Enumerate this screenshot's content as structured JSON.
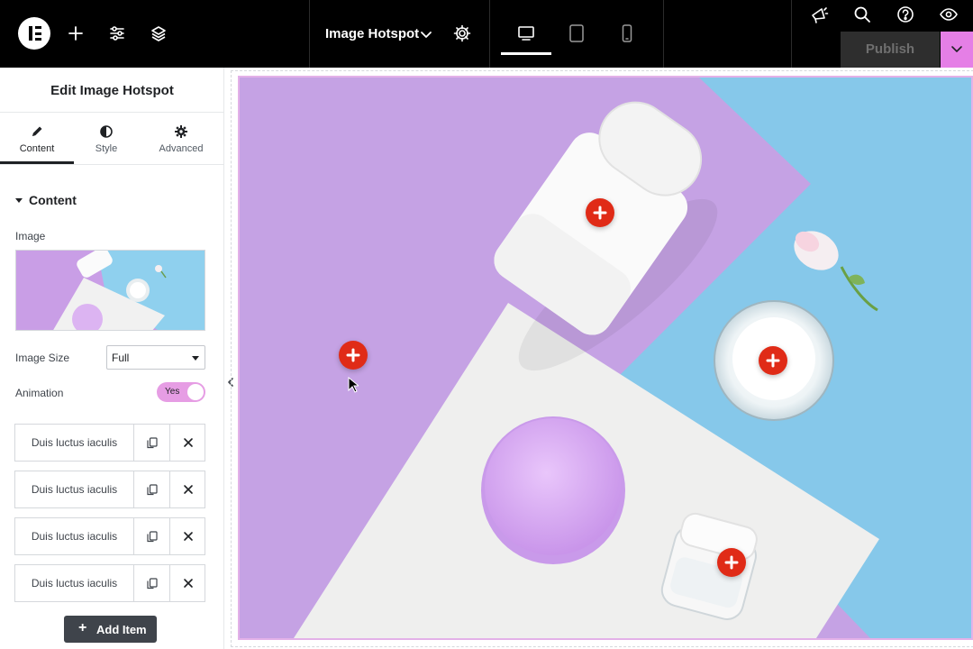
{
  "topbar": {
    "document_title": "Image Hotspot",
    "publish_label": "Publish",
    "accent_color": "#e57fe6"
  },
  "panel": {
    "title": "Edit Image Hotspot",
    "tabs": [
      {
        "label": "Content",
        "icon": "pencil-icon"
      },
      {
        "label": "Style",
        "icon": "half-circle-icon"
      },
      {
        "label": "Advanced",
        "icon": "gear-icon"
      }
    ],
    "section_title": "Content",
    "image_label": "Image",
    "image_size_label": "Image Size",
    "image_size_value": "Full",
    "animation_label": "Animation",
    "animation_value": "Yes",
    "items": [
      {
        "label": "Duis luctus iaculis"
      },
      {
        "label": "Duis luctus iaculis"
      },
      {
        "label": "Duis luctus iaculis"
      },
      {
        "label": "Duis luctus iaculis"
      }
    ],
    "add_item_label": "Add Item"
  },
  "canvas": {
    "hotspot_color": "#e02b17",
    "hotspot_count": 4
  }
}
